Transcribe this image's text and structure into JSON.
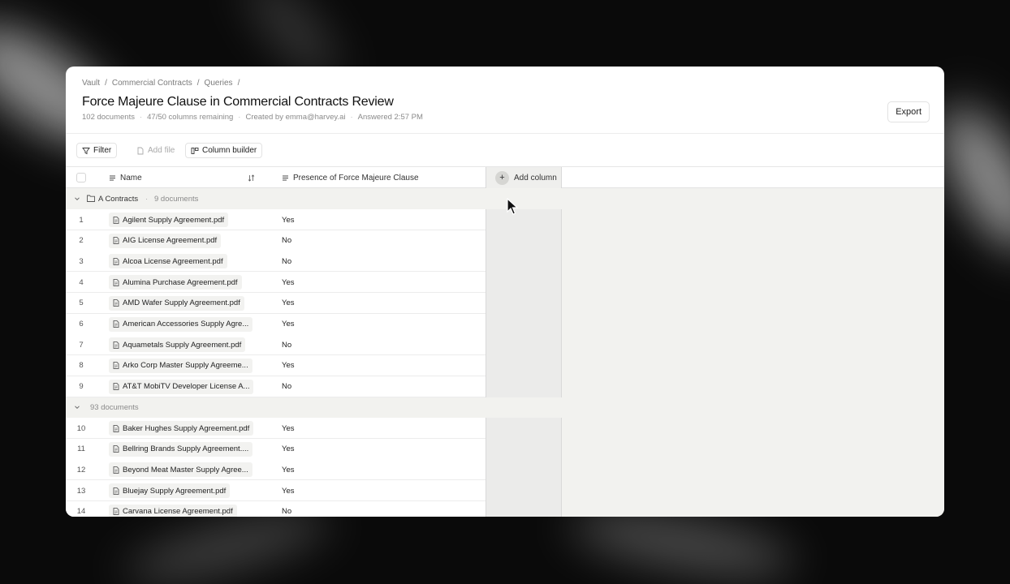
{
  "breadcrumb": [
    "Vault",
    "/",
    "Commercial Contracts",
    "/",
    "Queries",
    "/"
  ],
  "header": {
    "title": "Force Majeure Clause in Commercial Contracts Review",
    "meta": [
      "102 documents",
      "47/50 columns remaining",
      "Created by emma@harvey.ai",
      "Answered 2:57 PM"
    ],
    "meta_separator": "·",
    "export_label": "Export"
  },
  "toolbar": {
    "filter": "Filter",
    "add_file": "Add file",
    "column_builder": "Column builder"
  },
  "table": {
    "col_name": "Name",
    "col_clause": "Presence of Force Majeure Clause",
    "add_column": "Add column",
    "add_column_icon": "+",
    "groups": [
      {
        "name": "A Contracts",
        "count_label": "9 documents",
        "rows": [
          {
            "n": "1",
            "file": "Agilent Supply Agreement.pdf",
            "value": "Yes"
          },
          {
            "n": "2",
            "file": "AIG License Agreement.pdf",
            "value": "No"
          },
          {
            "n": "3",
            "file": "Alcoa License Agreement.pdf",
            "value": "No"
          },
          {
            "n": "4",
            "file": "Alumina Purchase Agreement.pdf",
            "value": "Yes"
          },
          {
            "n": "5",
            "file": "AMD Wafer Supply Agreement.pdf",
            "value": "Yes"
          },
          {
            "n": "6",
            "file": "American Accessories Supply Agre...",
            "value": "Yes"
          },
          {
            "n": "7",
            "file": "Aquametals Supply Agreement.pdf",
            "value": "No"
          },
          {
            "n": "8",
            "file": "Arko Corp Master Supply Agreeme...",
            "value": "Yes"
          },
          {
            "n": "9",
            "file": "AT&T MobiTV Developer License A...",
            "value": "No"
          }
        ]
      },
      {
        "name": "",
        "count_label": "93 documents",
        "rows": [
          {
            "n": "10",
            "file": "Baker Hughes Supply Agreement.pdf",
            "value": "Yes"
          },
          {
            "n": "11",
            "file": "Bellring Brands Supply Agreement....",
            "value": "Yes"
          },
          {
            "n": "12",
            "file": "Beyond Meat Master Supply Agree...",
            "value": "Yes"
          },
          {
            "n": "13",
            "file": "Bluejay Supply Agreement.pdf",
            "value": "Yes"
          },
          {
            "n": "14",
            "file": "Carvana License Agreement.pdf",
            "value": "No"
          }
        ]
      }
    ]
  }
}
